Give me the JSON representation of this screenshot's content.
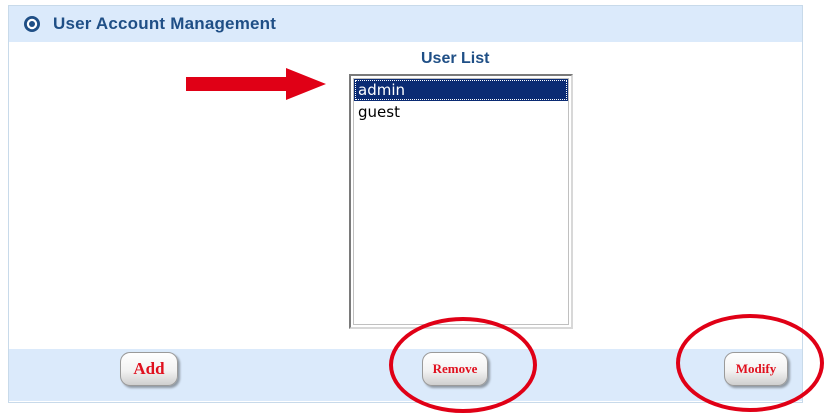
{
  "header": {
    "icon": "settings-circle-icon",
    "title": "User Account Management"
  },
  "user_list": {
    "label": "User List",
    "items": [
      {
        "name": "admin",
        "selected": true
      },
      {
        "name": "guest",
        "selected": false
      }
    ]
  },
  "annotations": {
    "arrow_color": "#e00016",
    "circle_color": "#e00016"
  },
  "buttons": {
    "add": "Add",
    "remove": "Remove",
    "modify": "Modify"
  }
}
